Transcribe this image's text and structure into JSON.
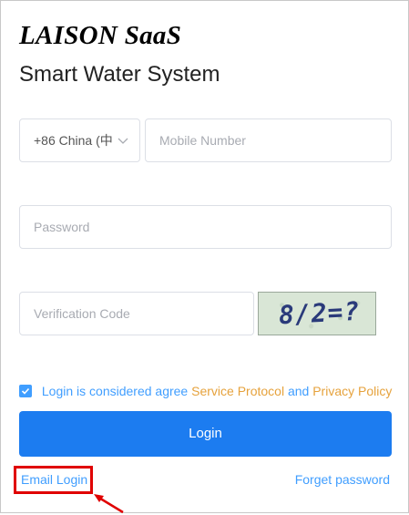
{
  "header": {
    "brand": "LAISON SaaS",
    "subtitle": "Smart Water System"
  },
  "form": {
    "country_value": "+86 China (中",
    "mobile_placeholder": "Mobile Number",
    "password_placeholder": "Password",
    "verification_placeholder": "Verification Code",
    "captcha_text": "8/2=?"
  },
  "agreement": {
    "checked": true,
    "prefix": "Login is considered agree",
    "service_protocol": "Service Protocol",
    "and": "and",
    "privacy_policy": "Privacy Policy"
  },
  "actions": {
    "login_label": "Login",
    "email_login_label": "Email Login",
    "forget_password_label": "Forget password"
  },
  "colors": {
    "primary": "#1c7cf0",
    "link": "#409eff",
    "orange_link": "#e6a23c",
    "annotation": "#e00000"
  }
}
